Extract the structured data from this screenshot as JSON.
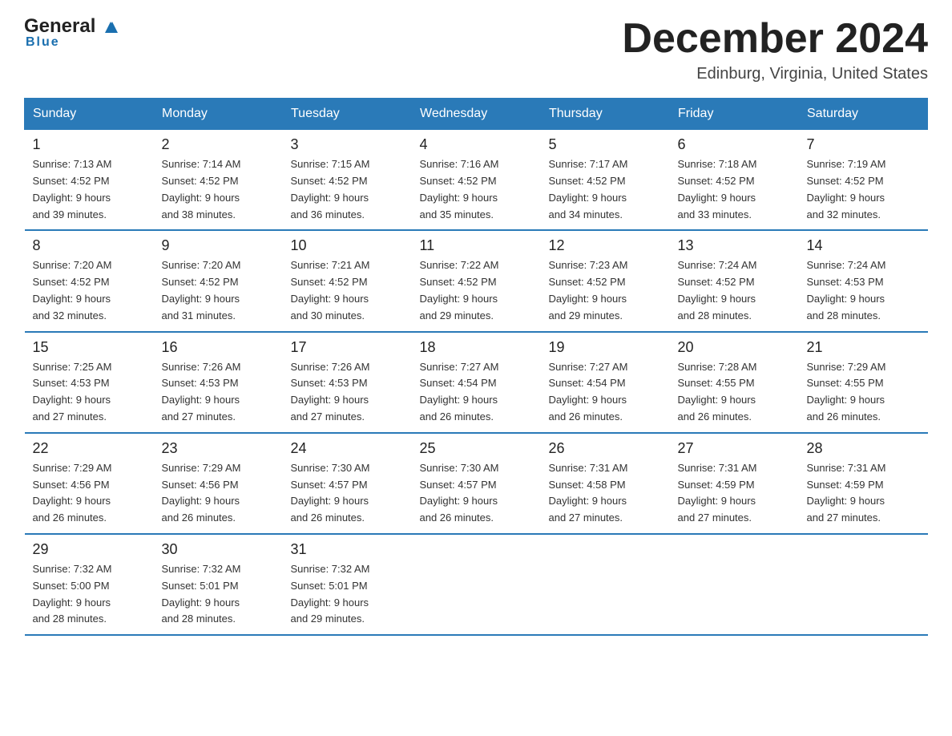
{
  "header": {
    "logo_name": "General",
    "logo_sub": "Blue",
    "title": "December 2024",
    "subtitle": "Edinburg, Virginia, United States"
  },
  "weekdays": [
    "Sunday",
    "Monday",
    "Tuesday",
    "Wednesday",
    "Thursday",
    "Friday",
    "Saturday"
  ],
  "weeks": [
    [
      {
        "day": "1",
        "sunrise": "7:13 AM",
        "sunset": "4:52 PM",
        "daylight": "9 hours and 39 minutes."
      },
      {
        "day": "2",
        "sunrise": "7:14 AM",
        "sunset": "4:52 PM",
        "daylight": "9 hours and 38 minutes."
      },
      {
        "day": "3",
        "sunrise": "7:15 AM",
        "sunset": "4:52 PM",
        "daylight": "9 hours and 36 minutes."
      },
      {
        "day": "4",
        "sunrise": "7:16 AM",
        "sunset": "4:52 PM",
        "daylight": "9 hours and 35 minutes."
      },
      {
        "day": "5",
        "sunrise": "7:17 AM",
        "sunset": "4:52 PM",
        "daylight": "9 hours and 34 minutes."
      },
      {
        "day": "6",
        "sunrise": "7:18 AM",
        "sunset": "4:52 PM",
        "daylight": "9 hours and 33 minutes."
      },
      {
        "day": "7",
        "sunrise": "7:19 AM",
        "sunset": "4:52 PM",
        "daylight": "9 hours and 32 minutes."
      }
    ],
    [
      {
        "day": "8",
        "sunrise": "7:20 AM",
        "sunset": "4:52 PM",
        "daylight": "9 hours and 32 minutes."
      },
      {
        "day": "9",
        "sunrise": "7:20 AM",
        "sunset": "4:52 PM",
        "daylight": "9 hours and 31 minutes."
      },
      {
        "day": "10",
        "sunrise": "7:21 AM",
        "sunset": "4:52 PM",
        "daylight": "9 hours and 30 minutes."
      },
      {
        "day": "11",
        "sunrise": "7:22 AM",
        "sunset": "4:52 PM",
        "daylight": "9 hours and 29 minutes."
      },
      {
        "day": "12",
        "sunrise": "7:23 AM",
        "sunset": "4:52 PM",
        "daylight": "9 hours and 29 minutes."
      },
      {
        "day": "13",
        "sunrise": "7:24 AM",
        "sunset": "4:52 PM",
        "daylight": "9 hours and 28 minutes."
      },
      {
        "day": "14",
        "sunrise": "7:24 AM",
        "sunset": "4:53 PM",
        "daylight": "9 hours and 28 minutes."
      }
    ],
    [
      {
        "day": "15",
        "sunrise": "7:25 AM",
        "sunset": "4:53 PM",
        "daylight": "9 hours and 27 minutes."
      },
      {
        "day": "16",
        "sunrise": "7:26 AM",
        "sunset": "4:53 PM",
        "daylight": "9 hours and 27 minutes."
      },
      {
        "day": "17",
        "sunrise": "7:26 AM",
        "sunset": "4:53 PM",
        "daylight": "9 hours and 27 minutes."
      },
      {
        "day": "18",
        "sunrise": "7:27 AM",
        "sunset": "4:54 PM",
        "daylight": "9 hours and 26 minutes."
      },
      {
        "day": "19",
        "sunrise": "7:27 AM",
        "sunset": "4:54 PM",
        "daylight": "9 hours and 26 minutes."
      },
      {
        "day": "20",
        "sunrise": "7:28 AM",
        "sunset": "4:55 PM",
        "daylight": "9 hours and 26 minutes."
      },
      {
        "day": "21",
        "sunrise": "7:29 AM",
        "sunset": "4:55 PM",
        "daylight": "9 hours and 26 minutes."
      }
    ],
    [
      {
        "day": "22",
        "sunrise": "7:29 AM",
        "sunset": "4:56 PM",
        "daylight": "9 hours and 26 minutes."
      },
      {
        "day": "23",
        "sunrise": "7:29 AM",
        "sunset": "4:56 PM",
        "daylight": "9 hours and 26 minutes."
      },
      {
        "day": "24",
        "sunrise": "7:30 AM",
        "sunset": "4:57 PM",
        "daylight": "9 hours and 26 minutes."
      },
      {
        "day": "25",
        "sunrise": "7:30 AM",
        "sunset": "4:57 PM",
        "daylight": "9 hours and 26 minutes."
      },
      {
        "day": "26",
        "sunrise": "7:31 AM",
        "sunset": "4:58 PM",
        "daylight": "9 hours and 27 minutes."
      },
      {
        "day": "27",
        "sunrise": "7:31 AM",
        "sunset": "4:59 PM",
        "daylight": "9 hours and 27 minutes."
      },
      {
        "day": "28",
        "sunrise": "7:31 AM",
        "sunset": "4:59 PM",
        "daylight": "9 hours and 27 minutes."
      }
    ],
    [
      {
        "day": "29",
        "sunrise": "7:32 AM",
        "sunset": "5:00 PM",
        "daylight": "9 hours and 28 minutes."
      },
      {
        "day": "30",
        "sunrise": "7:32 AM",
        "sunset": "5:01 PM",
        "daylight": "9 hours and 28 minutes."
      },
      {
        "day": "31",
        "sunrise": "7:32 AM",
        "sunset": "5:01 PM",
        "daylight": "9 hours and 29 minutes."
      },
      {
        "day": "",
        "sunrise": "",
        "sunset": "",
        "daylight": ""
      },
      {
        "day": "",
        "sunrise": "",
        "sunset": "",
        "daylight": ""
      },
      {
        "day": "",
        "sunrise": "",
        "sunset": "",
        "daylight": ""
      },
      {
        "day": "",
        "sunrise": "",
        "sunset": "",
        "daylight": ""
      }
    ]
  ],
  "labels": {
    "sunrise_prefix": "Sunrise: ",
    "sunset_prefix": "Sunset: ",
    "daylight_prefix": "Daylight: "
  }
}
